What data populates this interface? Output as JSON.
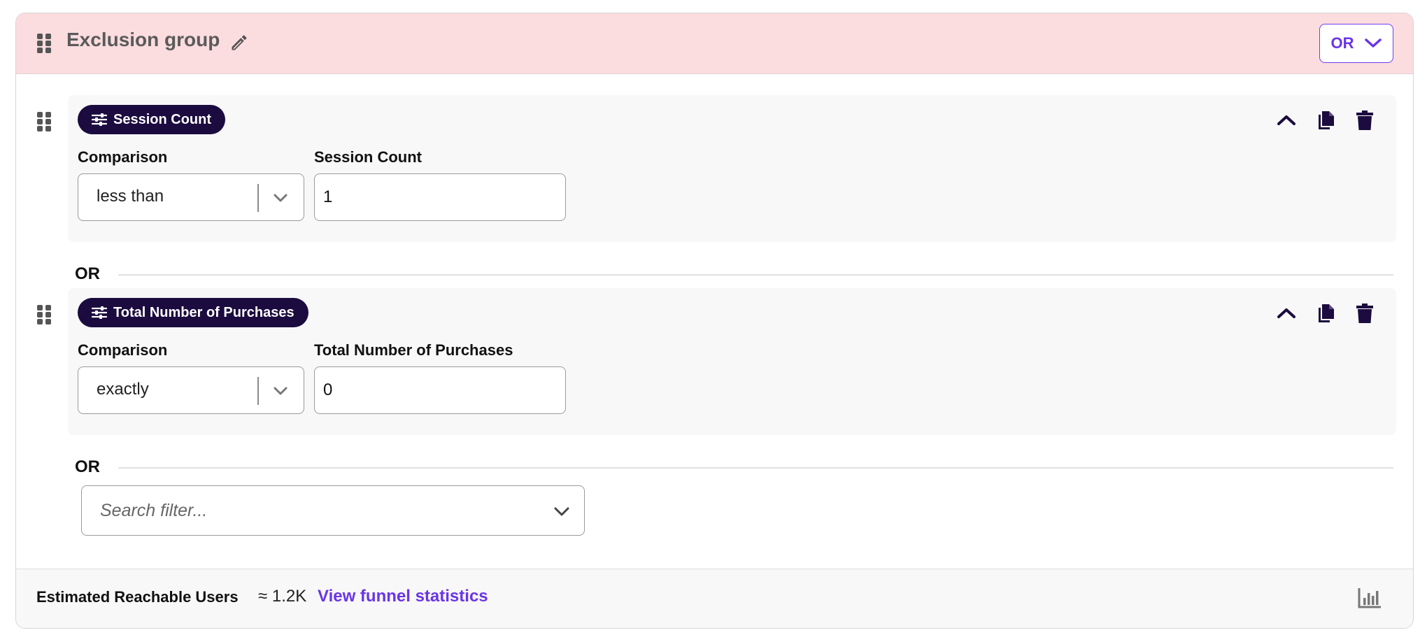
{
  "group": {
    "title": "Exclusion group",
    "operator": "OR"
  },
  "filters": [
    {
      "name": "Session Count",
      "comparison_label": "Comparison",
      "comparison_value": "less than",
      "value_label": "Session Count",
      "value": "1"
    },
    {
      "name": "Total Number of Purchases",
      "comparison_label": "Comparison",
      "comparison_value": "exactly",
      "value_label": "Total Number of Purchases",
      "value": "0"
    }
  ],
  "separator_label": "OR",
  "search": {
    "placeholder": "Search filter..."
  },
  "footer": {
    "estimate_label": "Estimated Reachable Users",
    "estimate_value": "≈ 1.2K",
    "link_label": "View funnel statistics"
  },
  "colors": {
    "header_bg": "#fbdcdf",
    "pill_bg": "#1b0b3f",
    "accent": "#6a35e8"
  },
  "icons": {
    "drag": "drag-handle-icon",
    "edit": "pencil-icon",
    "filter": "sliders-icon",
    "collapse": "chevron-up-icon",
    "duplicate": "copy-icon",
    "delete": "trash-icon",
    "stats": "bar-chart-icon"
  }
}
